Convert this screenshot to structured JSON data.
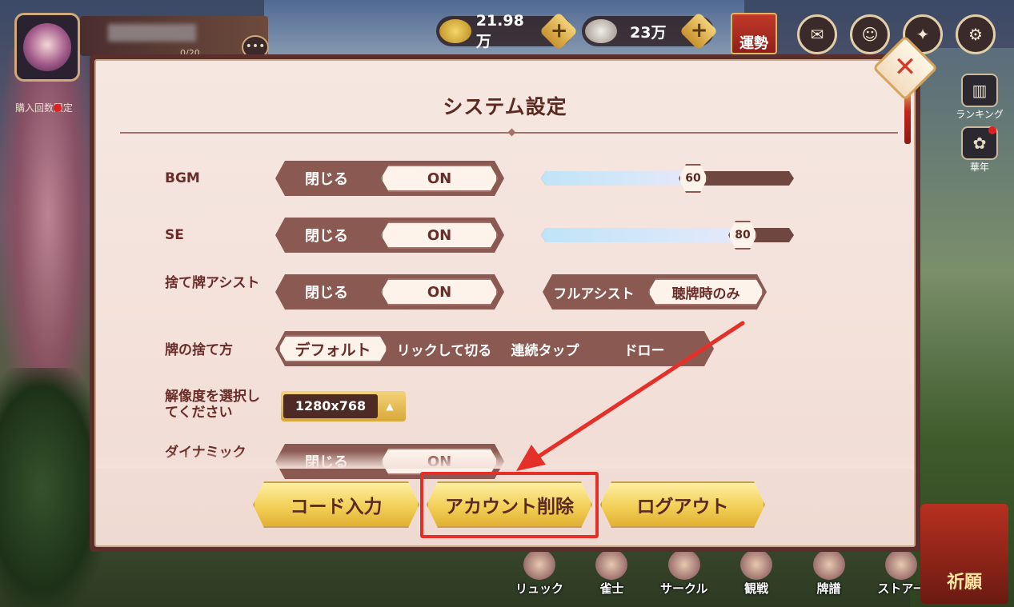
{
  "header": {
    "level_text": "0/20",
    "more_label": "•••",
    "purchase_limit_label": "購入回数限定",
    "currencies": [
      {
        "name": "coin",
        "value": "21.98万"
      },
      {
        "name": "shell",
        "value": "23万"
      }
    ],
    "plus_label": "+",
    "fortune_label": "運勢",
    "top_icons": [
      "mail-icon",
      "friends-icon",
      "announcement-icon",
      "settings-icon"
    ]
  },
  "side_menu": [
    {
      "label": "ランキング",
      "icon": "ranking-icon"
    },
    {
      "label": "華年",
      "icon": "flower-icon"
    }
  ],
  "dialog": {
    "title": "システム設定",
    "close_label": "✕",
    "settings": {
      "bgm": {
        "label": "BGM",
        "off_label": "閉じる",
        "on_label": "ON",
        "selected": "ON",
        "volume": 60
      },
      "se": {
        "label": "SE",
        "off_label": "閉じる",
        "on_label": "ON",
        "selected": "ON",
        "volume": 80
      },
      "discard_assist": {
        "label": "捨て牌アシスト",
        "off_label": "閉じる",
        "on_label": "ON",
        "selected": "ON",
        "mode_full": "フルアシスト",
        "mode_tenpai": "聴牌時のみ",
        "mode_selected": "聴牌時のみ"
      },
      "discard_method": {
        "label": "牌の捨て方",
        "options": [
          "デフォルト",
          "リックして切る",
          "連続タップ",
          "ドロー"
        ],
        "selected": "デフォルト"
      },
      "resolution": {
        "label": "解像度を選択してください",
        "value": "1280x768",
        "arrow": "▲"
      },
      "dynamic": {
        "label": "ダイナミック",
        "off_label": "閉じる",
        "on_label": "ON"
      }
    },
    "buttons": {
      "code_input": "コード入力",
      "delete_account": "アカウント削除",
      "logout": "ログアウト"
    }
  },
  "bottom_nav": [
    "リュック",
    "雀士",
    "サークル",
    "観戦",
    "牌譜",
    "ストアー"
  ],
  "gacha_label": "祈願",
  "colors": {
    "accent_red": "#e5302a",
    "button_gold": "#f2cf57",
    "text_brown": "#6a2c28",
    "toggle_bg": "#8a5a52"
  }
}
